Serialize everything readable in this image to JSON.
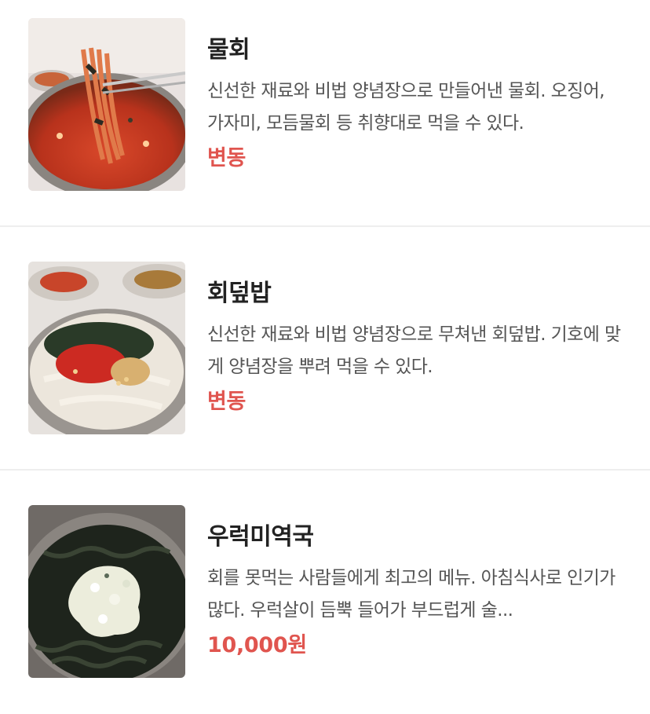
{
  "menu": {
    "items": [
      {
        "name": "물회",
        "description": "신선한 재료와 비법 양념장으로 만들어낸 물회. 오징어, 가자미, 모듬물회 등 취향대로 먹을 수 있다.",
        "price": "변동",
        "image": "mulhoe-photo"
      },
      {
        "name": "회덮밥",
        "description": "신선한 재료와 비법 양념장으로 무쳐낸 회덮밥. 기호에 맞게 양념장을 뿌려 먹을 수 있다.",
        "price": "변동",
        "image": "hoedeopbap-photo"
      },
      {
        "name": "우럭미역국",
        "description": "회를 못먹는 사람들에게 최고의 메뉴. 아침식사로 인기가 많다. 우럭살이 듬뿍 들어가 부드럽게 술...",
        "price": "10,000원",
        "image": "ureok-miyeokguk-photo"
      }
    ]
  },
  "colors": {
    "price": "#e0554f",
    "divider": "#eeeeee",
    "title": "#222222",
    "description": "#555555"
  }
}
